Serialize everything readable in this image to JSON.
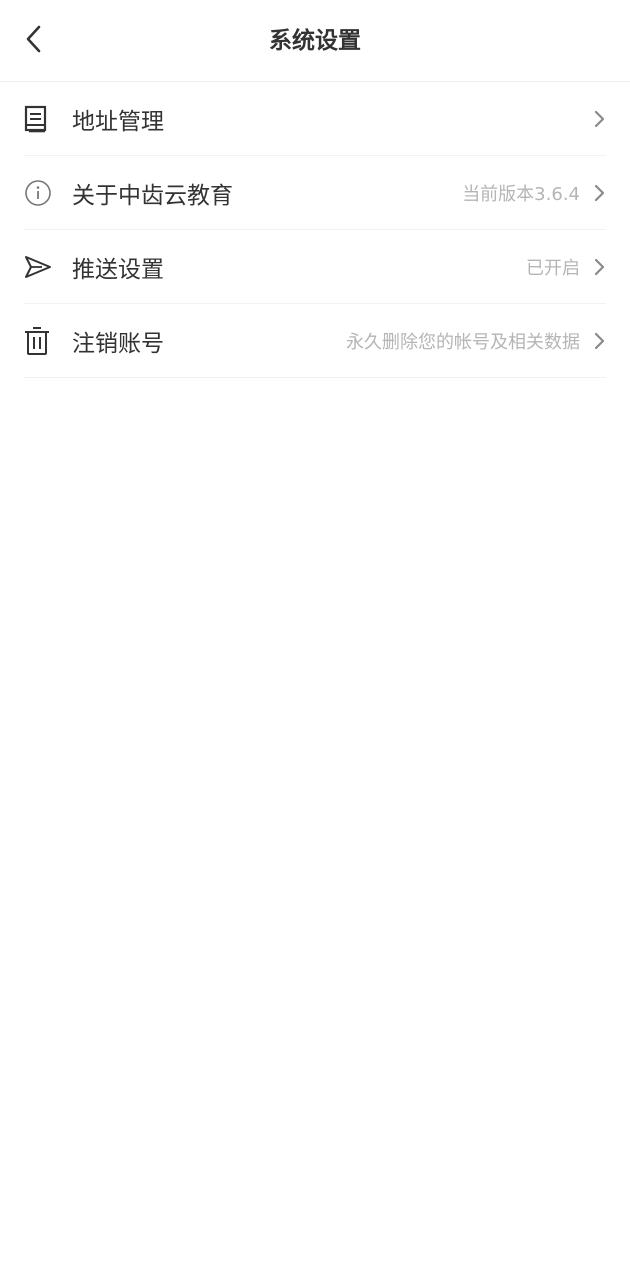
{
  "header": {
    "title": "系统设置",
    "back_icon": "chevron-left-icon"
  },
  "settings": {
    "items": [
      {
        "label": "地址管理",
        "value": "",
        "icon": "book-icon"
      },
      {
        "label": "关于中齿云教育",
        "value": "当前版本3.6.4",
        "icon": "info-icon"
      },
      {
        "label": "推送设置",
        "value": "已开启",
        "icon": "send-icon"
      },
      {
        "label": "注销账号",
        "value": "永久删除您的帐号及相关数据",
        "icon": "trash-icon"
      }
    ]
  },
  "colors": {
    "text_primary": "#333333",
    "text_secondary": "#b5b5b5",
    "divider": "#eeeeee",
    "background": "#ffffff"
  }
}
